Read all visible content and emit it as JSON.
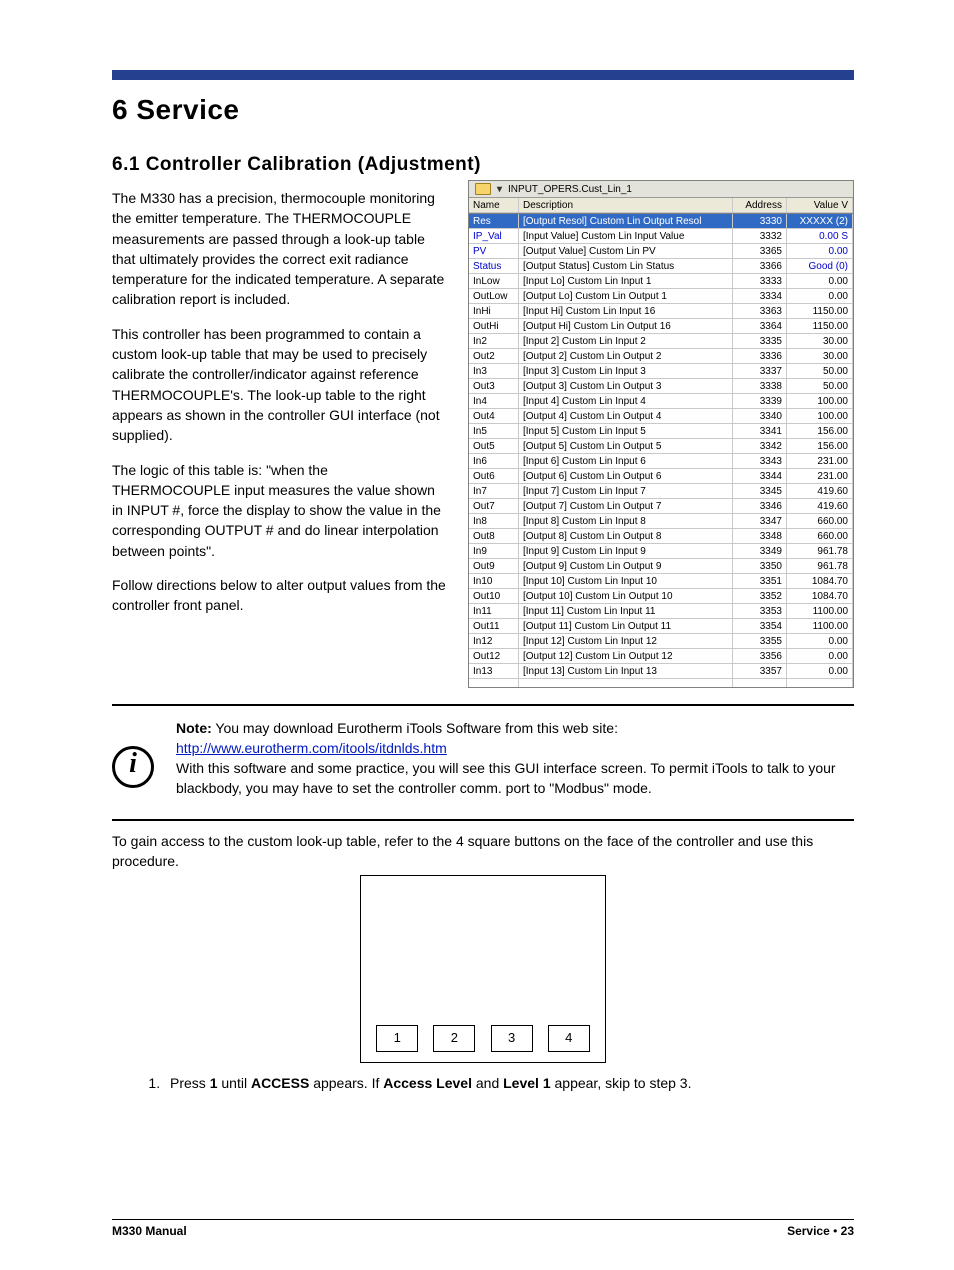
{
  "chapter_title": "6  Service",
  "section_title": "6.1   Controller Calibration (Adjustment)",
  "paragraphs": {
    "p1": "The M330 has a precision, thermocouple monitoring the emitter temperature.  The THERMOCOUPLE measurements are passed through a look-up table that ultimately provides the correct exit radiance temperature for the indicated temperature.  A separate calibration report is included.",
    "p2": "This controller has been programmed to contain a custom look-up table that may be used to precisely calibrate the controller/indicator against reference THERMOCOUPLE's.  The look-up table to the right appears as shown in the controller GUI interface (not supplied).",
    "p3": "The logic of this table is: \"when the THERMOCOUPLE input measures the value shown in INPUT #, force the display to show the value in the corresponding OUTPUT # and do linear interpolation between points\".",
    "p4": "Follow directions below to alter output values from the controller front panel."
  },
  "gui": {
    "title": "INPUT_OPERS.Cust_Lin_1",
    "headers": {
      "name": "Name",
      "desc": "Description",
      "addr": "Address",
      "val": "Value"
    },
    "val_hdr_cut": "V",
    "rows": [
      {
        "name": "Res",
        "desc": "[Output Resol]  Custom Lin Output Resol",
        "addr": "3330",
        "val": "XXXXX (2)",
        "selected": true
      },
      {
        "name": "IP_Val",
        "desc": "[Input Value]  Custom Lin Input Value",
        "addr": "3332",
        "val": "0.00",
        "suffix": "S",
        "blue": true
      },
      {
        "name": "PV",
        "desc": "[Output Value]  Custom Lin PV",
        "addr": "3365",
        "val": "0.00",
        "blue": true
      },
      {
        "name": "Status",
        "desc": "[Output Status]  Custom Lin Status",
        "addr": "3366",
        "val": "Good (0)",
        "blue": true
      },
      {
        "name": "InLow",
        "desc": "[Input Lo]  Custom Lin Input 1",
        "addr": "3333",
        "val": "0.00"
      },
      {
        "name": "OutLow",
        "desc": "[Output Lo]  Custom Lin Output 1",
        "addr": "3334",
        "val": "0.00"
      },
      {
        "name": "InHi",
        "desc": "[Input Hi]  Custom Lin Input 16",
        "addr": "3363",
        "val": "1150.00"
      },
      {
        "name": "OutHi",
        "desc": "[Output Hi]  Custom Lin Output 16",
        "addr": "3364",
        "val": "1150.00"
      },
      {
        "name": "In2",
        "desc": "[Input 2]  Custom Lin Input 2",
        "addr": "3335",
        "val": "30.00"
      },
      {
        "name": "Out2",
        "desc": "[Output 2]  Custom Lin Output 2",
        "addr": "3336",
        "val": "30.00"
      },
      {
        "name": "In3",
        "desc": "[Input 3]  Custom Lin Input 3",
        "addr": "3337",
        "val": "50.00"
      },
      {
        "name": "Out3",
        "desc": "[Output 3]  Custom Lin Output 3",
        "addr": "3338",
        "val": "50.00"
      },
      {
        "name": "In4",
        "desc": "[Input 4]  Custom Lin Input 4",
        "addr": "3339",
        "val": "100.00"
      },
      {
        "name": "Out4",
        "desc": "[Output 4]  Custom Lin Output 4",
        "addr": "3340",
        "val": "100.00"
      },
      {
        "name": "In5",
        "desc": "[Input 5]  Custom Lin Input 5",
        "addr": "3341",
        "val": "156.00"
      },
      {
        "name": "Out5",
        "desc": "[Output 5]  Custom Lin Output 5",
        "addr": "3342",
        "val": "156.00"
      },
      {
        "name": "In6",
        "desc": "[Input 6]  Custom Lin Input 6",
        "addr": "3343",
        "val": "231.00"
      },
      {
        "name": "Out6",
        "desc": "[Output 6]  Custom Lin Output 6",
        "addr": "3344",
        "val": "231.00"
      },
      {
        "name": "In7",
        "desc": "[Input 7]  Custom Lin Input 7",
        "addr": "3345",
        "val": "419.60"
      },
      {
        "name": "Out7",
        "desc": "[Output 7]  Custom Lin Output 7",
        "addr": "3346",
        "val": "419.60"
      },
      {
        "name": "In8",
        "desc": "[Input 8]  Custom Lin Input 8",
        "addr": "3347",
        "val": "660.00"
      },
      {
        "name": "Out8",
        "desc": "[Output 8]  Custom Lin Output 8",
        "addr": "3348",
        "val": "660.00"
      },
      {
        "name": "In9",
        "desc": "[Input 9]  Custom Lin Input 9",
        "addr": "3349",
        "val": "961.78"
      },
      {
        "name": "Out9",
        "desc": "[Output 9]  Custom Lin Output 9",
        "addr": "3350",
        "val": "961.78"
      },
      {
        "name": "In10",
        "desc": "[Input 10]  Custom Lin Input 10",
        "addr": "3351",
        "val": "1084.70"
      },
      {
        "name": "Out10",
        "desc": "[Output 10]  Custom Lin Output 10",
        "addr": "3352",
        "val": "1084.70"
      },
      {
        "name": "In11",
        "desc": "[Input 11]  Custom Lin Input 11",
        "addr": "3353",
        "val": "1100.00"
      },
      {
        "name": "Out11",
        "desc": "[Output 11]  Custom Lin Output 11",
        "addr": "3354",
        "val": "1100.00"
      },
      {
        "name": "In12",
        "desc": "[Input 12]  Custom Lin Input 12",
        "addr": "3355",
        "val": "0.00"
      },
      {
        "name": "Out12",
        "desc": "[Output 12]  Custom Lin Output 12",
        "addr": "3356",
        "val": "0.00"
      },
      {
        "name": "In13",
        "desc": "[Input 13]  Custom Lin Input 13",
        "addr": "3357",
        "val": "0.00"
      }
    ]
  },
  "note": {
    "label": "Note:",
    "line1": " You may download Eurotherm iTools Software from this web site:",
    "url": "http://www.eurotherm.com/itools/itdnlds.htm",
    "line2": "With this software and some practice, you will see this GUI interface screen.   To permit iTools to talk to your blackbody, you may have to set the controller comm. port to \"Modbus\" mode."
  },
  "procedure_intro": "To gain access to the custom look-up table,  refer to the 4 square buttons on the face of the controller and use this procedure.",
  "buttons": [
    "1",
    "2",
    "3",
    "4"
  ],
  "step1_pre": "Press ",
  "step1_b1": "1",
  "step1_mid1": " until ",
  "step1_b2": "ACCESS",
  "step1_mid2": " appears.  If ",
  "step1_b3": "Access Level",
  "step1_mid3": " and ",
  "step1_b4": "Level 1",
  "step1_post": " appear, skip to step 3.",
  "footer": {
    "left": "M330 Manual",
    "right_section": "Service",
    "bullet": " • ",
    "page": "23"
  }
}
